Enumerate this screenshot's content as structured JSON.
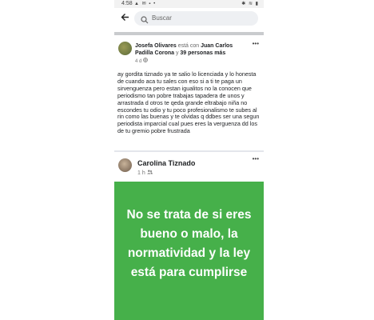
{
  "status_bar": {
    "time": "4:58",
    "left_icons": "▲ ✉ ▪ •",
    "right_icons": "✱ ≋ ▮"
  },
  "top_bar": {
    "back_icon": "arrow-left-icon",
    "search_placeholder": "Buscar"
  },
  "post1": {
    "author": "Josefa Olivares",
    "connector": " está con ",
    "tagged": "Juan Carlos Padilla Corona",
    "and": " y ",
    "others": "39 personas más",
    "time": "4 d",
    "privacy_icon": "globe-icon",
    "more": "•••",
    "text": "ay gordita tiznado ya te salio lo licenciada y lo honesta de cuando aca tu sales con eso si a ti te paga un sirvenguenza pero estan igualitos no la conocen que periodismo tan pobre trabajas tapadera de unos y arrastrada d otros te qeda grande eltrabajo niña no escondes tu odio y tu poco profesionalismo te subes al rin como las buenas y te olvidas q ddbes ser una segun periodista imparcial cual pues eres la verguenza dd los de tu gremio pobre frustrada"
  },
  "post2": {
    "author": "Carolina Tiznado",
    "time": "1 h",
    "audience_icon": "friends-icon",
    "more": "•••",
    "image_text": "No se trata de si eres bueno o malo, la normatividad y la ley está para cumplirse"
  }
}
